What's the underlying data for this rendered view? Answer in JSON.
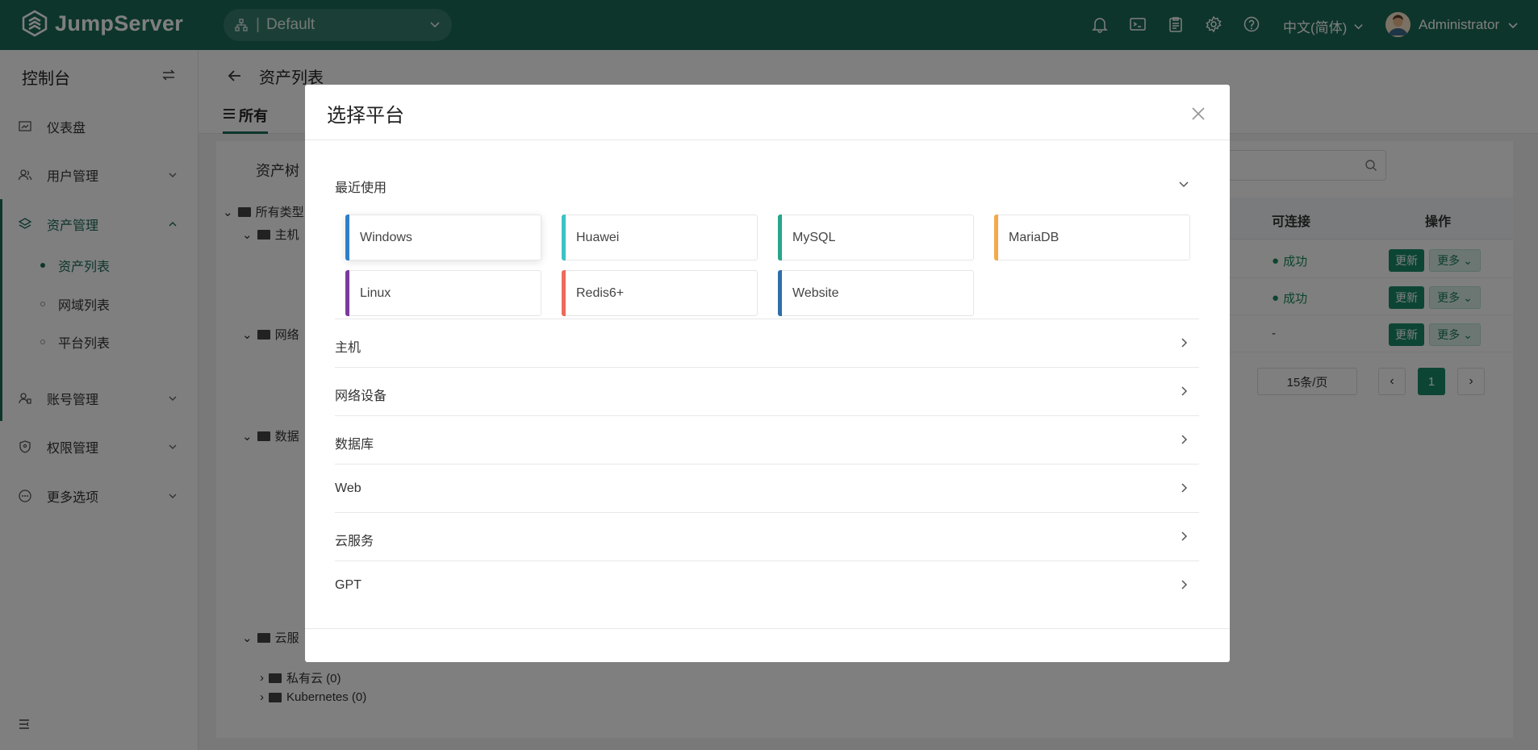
{
  "topbar": {
    "brand": "JumpServer",
    "org": "Default",
    "language": "中文(简体)",
    "username": "Administrator",
    "icons": [
      "bell-icon",
      "terminal-icon",
      "clipboard-icon",
      "gear-icon",
      "help-icon"
    ],
    "color": "#1a6b57"
  },
  "sidebar": {
    "title": "控制台",
    "items": [
      {
        "label": "仪表盘"
      },
      {
        "label": "用户管理"
      },
      {
        "label": "资产管理"
      },
      {
        "label": "账号管理"
      },
      {
        "label": "权限管理"
      },
      {
        "label": "更多选项"
      }
    ],
    "sub_items": [
      {
        "label": "资产列表"
      },
      {
        "label": "网域列表"
      },
      {
        "label": "平台列表"
      }
    ]
  },
  "page": {
    "title": "资产列表",
    "tab_all": "所有",
    "tree_title": "资产树",
    "tree": {
      "root": "所有类型",
      "host": "主机",
      "network": "网络",
      "database": "数据",
      "cloud": "云服",
      "private_cloud": "私有云 (0)",
      "kubernetes": "Kubernetes (0)"
    },
    "search_placeholder": "搜",
    "table": {
      "col_connectivity": "可连接",
      "col_actions": "操作",
      "rows": [
        {
          "status": "成功",
          "update": "更新",
          "more": "更多"
        },
        {
          "status": "成功",
          "update": "更新",
          "more": "更多"
        },
        {
          "status": "-",
          "update": "更新",
          "more": "更多"
        }
      ]
    },
    "pager": {
      "page_size": "15条/页",
      "current": "1"
    }
  },
  "modal": {
    "title": "选择平台",
    "recent_label": "最近使用",
    "recent": [
      {
        "name": "Windows",
        "color": "#2f80c8"
      },
      {
        "name": "Huawei",
        "color": "#3cc3c4"
      },
      {
        "name": "MySQL",
        "color": "#27a68a"
      },
      {
        "name": "MariaDB",
        "color": "#f4a94a"
      },
      {
        "name": "Linux",
        "color": "#7b3b9c"
      },
      {
        "name": "Redis6+",
        "color": "#ee6a5a"
      },
      {
        "name": "Website",
        "color": "#2f6ea8"
      }
    ],
    "sections": [
      {
        "label": "主机"
      },
      {
        "label": "网络设备"
      },
      {
        "label": "数据库"
      },
      {
        "label": "Web"
      },
      {
        "label": "云服务"
      },
      {
        "label": "GPT"
      }
    ]
  }
}
